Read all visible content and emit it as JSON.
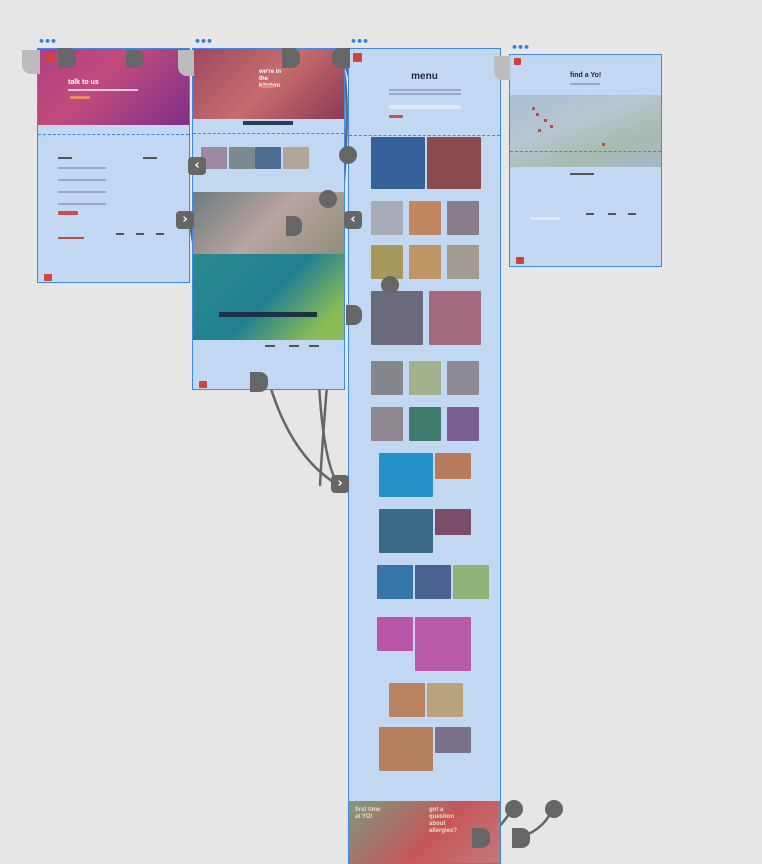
{
  "boards": {
    "contact": {
      "hero_title": "talk to us"
    },
    "sushi": {
      "hero_title": "we're in the kitchen"
    },
    "menu": {
      "title": "menu"
    },
    "find": {
      "title": "find a Yo!"
    }
  },
  "colors": {
    "board_fill": "#c2d8f2",
    "board_border": "#3d8ae6",
    "connector": "#666666",
    "accent_red": "#cf4c4c",
    "canvas": "#e6e6e6"
  },
  "icons": [
    "more-icon",
    "chevron-right-icon",
    "chevron-left-icon",
    "connector-handle-icon",
    "logo-icon"
  ]
}
